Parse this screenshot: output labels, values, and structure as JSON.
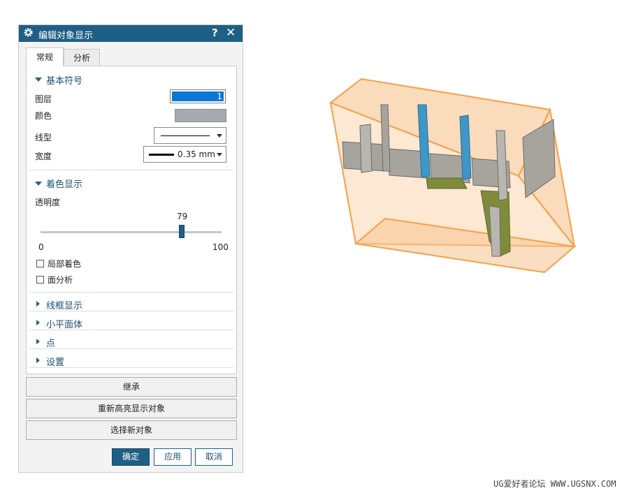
{
  "dialog": {
    "title": "编辑对象显示",
    "help_glyph": "?",
    "close_glyph": "✕",
    "tabs": [
      {
        "label": "常规",
        "active": true
      },
      {
        "label": "分析",
        "active": false
      }
    ],
    "basic_symbol": {
      "title": "基本符号",
      "layer_label": "图层",
      "layer_value": "1",
      "color_label": "颜色",
      "color_value": "#a6aaae",
      "linetype_label": "线型",
      "width_label": "宽度",
      "width_value": "0.35 mm"
    },
    "shading": {
      "title": "着色显示",
      "transparency_label": "透明度",
      "transparency_value": "79",
      "slider_min": "0",
      "slider_max": "100",
      "partial_shading_label": "局部着色",
      "partial_shading_checked": false,
      "face_analysis_label": "面分析",
      "face_analysis_checked": false
    },
    "collapsed_sections": [
      {
        "label": "线框显示"
      },
      {
        "label": "小平面体"
      },
      {
        "label": "点"
      },
      {
        "label": "设置"
      }
    ],
    "buttons": {
      "inherit": "继承",
      "rehighlight": "重新高亮显示对象",
      "select_new": "选择新对象",
      "ok": "确定",
      "apply": "应用",
      "cancel": "取消"
    }
  },
  "watermark": "UG爱好者论坛 WWW.UGSNX.COM",
  "colors": {
    "accent": "#1f5f86",
    "bounding_box": "#f5a04a",
    "part_gray": "#a7a49e",
    "part_blue": "#3d97c7",
    "part_green": "#7f8b3a"
  }
}
